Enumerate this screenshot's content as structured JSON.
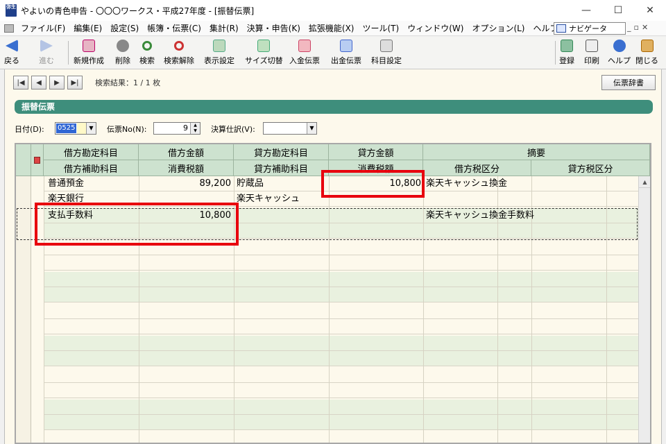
{
  "window": {
    "title": "やよいの青色申告 - 〇〇〇ワークス・平成27年度 - [振替伝票]",
    "app_icon_text": "弥生"
  },
  "menu": {
    "items": [
      "ファイル(F)",
      "編集(E)",
      "設定(S)",
      "帳簿・伝票(C)",
      "集計(R)",
      "決算・申告(K)",
      "拡張機能(X)",
      "ツール(T)",
      "ウィンドウ(W)",
      "オプション(L)",
      "ヘルプ(H)"
    ],
    "navigator": "ナビゲータ"
  },
  "toolbar": {
    "back": "戻る",
    "forward": "進む",
    "new": "新規作成",
    "delete": "削除",
    "search": "検索",
    "search_clear": "検索解除",
    "display_settings": "表示設定",
    "size_toggle": "サイズ切替",
    "deposit_slip": "入金伝票",
    "payment_slip": "出金伝票",
    "account_settings": "科目設定",
    "register": "登録",
    "print": "印刷",
    "help": "ヘルプ",
    "close": "閉じる"
  },
  "nav": {
    "search_result": "検索結果：1 / 1 枚",
    "slip_dictionary": "伝票辞書"
  },
  "section_title": "振替伝票",
  "form": {
    "date_label": "日付(D):",
    "date_value": "0525",
    "slip_no_label": "伝票No(N):",
    "slip_no_value": "9",
    "closing_label": "決算仕訳(V):",
    "closing_value": ""
  },
  "grid": {
    "headers_row1": [
      "借方勘定科目",
      "借方金額",
      "貸方勘定科目",
      "貸方金額",
      "摘要"
    ],
    "headers_row2": [
      "借方補助科目",
      "消費税額",
      "貸方補助科目",
      "消費税額",
      "借方税区分",
      "貸方税区分"
    ],
    "entries": [
      {
        "debit_account": "普通預金",
        "debit_amount": "89,200",
        "credit_account": "貯蔵品",
        "credit_amount": "10,800",
        "description": "楽天キャッシュ換金"
      },
      {
        "debit_sub": "楽天銀行",
        "credit_sub": "楽天キャッシュ"
      },
      {
        "debit_account": "支払手数料",
        "debit_amount": "10,800",
        "description": "楽天キャッシュ換金手数料"
      }
    ]
  },
  "highlight_color": "#e8000d"
}
